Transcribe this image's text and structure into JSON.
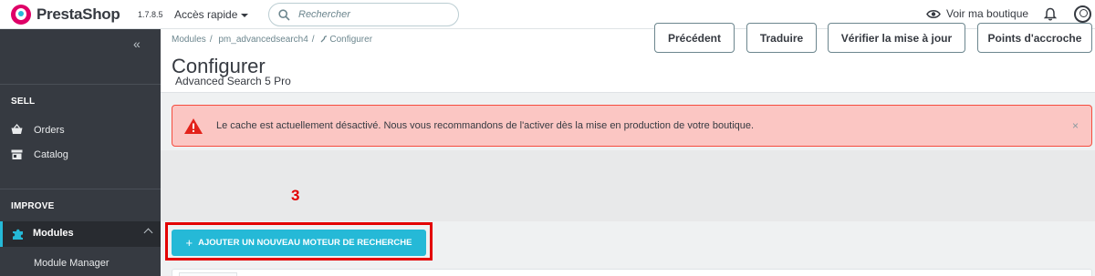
{
  "header": {
    "brand": "PrestaShop",
    "version": "1.7.8.5",
    "quick_access": "Accès rapide",
    "search_placeholder": "Rechercher",
    "view_shop": "Voir ma boutique"
  },
  "sidebar": {
    "collapse_glyph": "«",
    "sections": [
      {
        "title": "SELL",
        "items": [
          "Orders",
          "Catalog"
        ]
      },
      {
        "title": "IMPROVE",
        "items": [
          "Modules"
        ]
      }
    ],
    "active_item": "Modules",
    "sub_items": [
      "Module Manager"
    ]
  },
  "breadcrumb": [
    "Modules",
    "pm_advancedsearch4",
    "Configurer"
  ],
  "page": {
    "title": "Configurer",
    "subtitle": "Advanced Search 5 Pro",
    "toolbar": [
      "Précédent",
      "Traduire",
      "Vérifier la mise à jour",
      "Points d'accroche"
    ]
  },
  "alert": {
    "message": "Le cache est actuellement désactivé. Nous vous recommandons de l'activer dès la mise en production de votre boutique.",
    "close": "×"
  },
  "annotation": {
    "step": "3",
    "color": "#e30000"
  },
  "add_button": {
    "plus": "+",
    "label": "AJOUTER UN NOUVEAU MOTEUR DE RECHERCHE"
  },
  "colors": {
    "accent": "#25b9d7",
    "sidebar": "#363a41",
    "brand": "#df0067",
    "alert_bg": "#fbc6c3",
    "alert_border": "#f54c3e"
  },
  "icons": [
    "search-icon",
    "eye-icon",
    "bell-icon",
    "user-icon",
    "cart-icon",
    "store-icon",
    "puzzle-icon",
    "warning-icon",
    "wrench-icon"
  ]
}
